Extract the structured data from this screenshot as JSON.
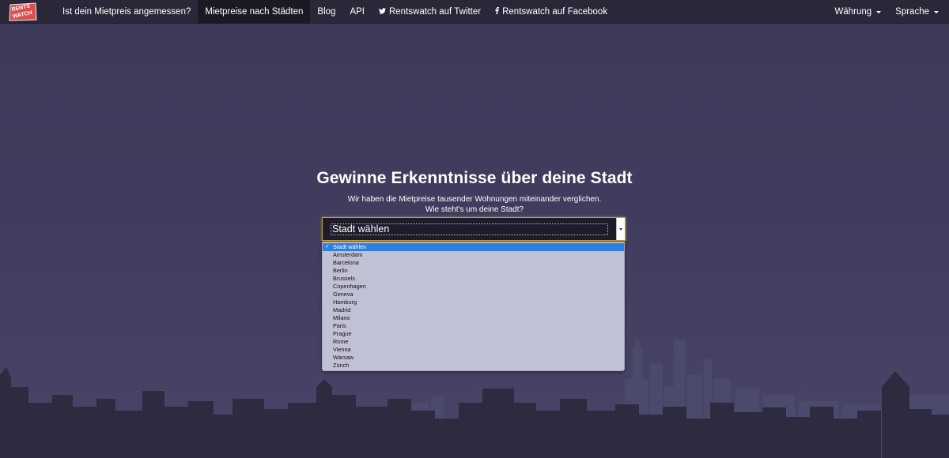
{
  "navbar": {
    "logo_text": "RENTS WATCH",
    "links": [
      {
        "label": "Ist dein Mietpreis angemessen?",
        "active": false
      },
      {
        "label": "Mietpreise nach Städten",
        "active": true
      },
      {
        "label": "Blog",
        "active": false
      },
      {
        "label": "API",
        "active": false
      },
      {
        "label": "Rentswatch auf Twitter",
        "active": false,
        "icon": "twitter-icon"
      },
      {
        "label": "Rentswatch auf Facebook",
        "active": false,
        "icon": "facebook-icon"
      }
    ],
    "right": [
      {
        "label": "Währung",
        "icon": "caret-down-icon"
      },
      {
        "label": "Sprache",
        "icon": "caret-down-icon"
      }
    ]
  },
  "hero": {
    "title": "Gewinne Erkenntnisse über deine Stadt",
    "subtitle_line1": "Wir haben die Mietpreise tausender Wohnungen miteinander verglichen.",
    "subtitle_line2": "Wie steht's um deine Stadt?"
  },
  "city_select": {
    "selected": "Stadt wählen",
    "options": [
      "Stadt wählen",
      "Amsterdam",
      "Barcelona",
      "Berlin",
      "Brussels",
      "Copenhagen",
      "Geneva",
      "Hamburg",
      "Madrid",
      "Milano",
      "Paris",
      "Prague",
      "Rome",
      "Vienna",
      "Warsaw",
      "Zürich"
    ],
    "selected_index": 0,
    "check_mark": "✓"
  },
  "colors": {
    "background": "#403c5e",
    "navbar": "#2a2838",
    "navbar_active": "#1b1a24",
    "skyline_dark": "#2e2a40",
    "skyline_light": "#4b4a6c",
    "dropdown_bg": "#c1c1d6",
    "highlight": "#2f7fdf",
    "select_border": "#c7a22c"
  }
}
